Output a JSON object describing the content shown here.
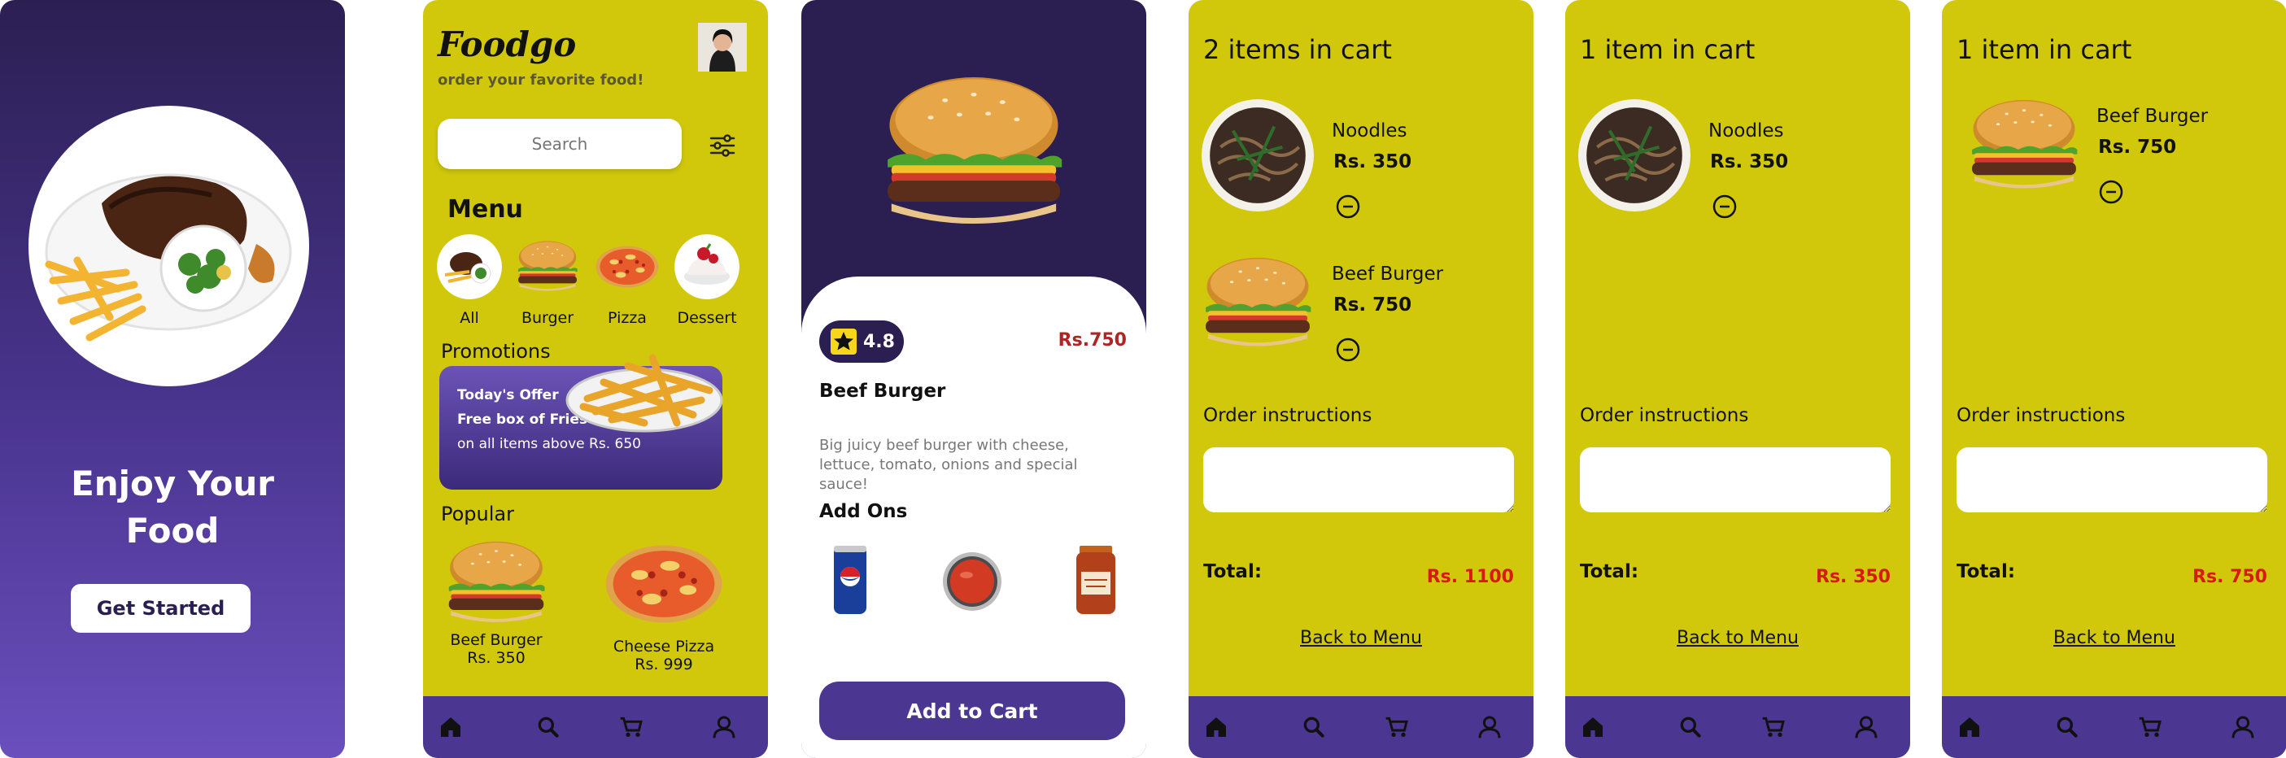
{
  "splash": {
    "title_line1": "Enjoy Your",
    "title_line2": "Food",
    "cta": "Get Started"
  },
  "home": {
    "brand": "Foodgo",
    "tagline": "order your favorite food!",
    "search_placeholder": "Search",
    "menu_title": "Menu",
    "categories": [
      {
        "label": "All",
        "icon": "steak-plate"
      },
      {
        "label": "Burger",
        "icon": "burger"
      },
      {
        "label": "Pizza",
        "icon": "pizza"
      },
      {
        "label": "Dessert",
        "icon": "dessert"
      }
    ],
    "promotions_title": "Promotions",
    "promo": {
      "line1": "Today's Offer",
      "line2": "Free box of Fries",
      "line3": "on all items above Rs. 650"
    },
    "popular_title": "Popular",
    "popular": [
      {
        "name": "Beef Burger",
        "price": "Rs. 350"
      },
      {
        "name": "Cheese Pizza",
        "price": "Rs. 999"
      }
    ]
  },
  "detail": {
    "rating": "4.8",
    "price": "Rs.750",
    "name": "Beef Burger",
    "description": "Big juicy beef burger with cheese, lettuce, tomato, onions and special sauce!",
    "addons_title": "Add Ons",
    "addons": [
      "pepsi-can",
      "tomato-sauce-bowl",
      "sauce-jar"
    ],
    "cta": "Add to Cart"
  },
  "carts": [
    {
      "title": "2 items in cart",
      "items": [
        {
          "name": "Noodles",
          "price": "Rs. 350"
        },
        {
          "name": "Beef Burger",
          "price": "Rs. 750"
        }
      ],
      "order_instructions_label": "Order instructions",
      "total_label": "Total:",
      "total": "Rs. 1100",
      "back": "Back to Menu"
    },
    {
      "title": "1 item in cart",
      "items": [
        {
          "name": "Noodles",
          "price": "Rs. 350"
        }
      ],
      "order_instructions_label": "Order instructions",
      "total_label": "Total:",
      "total": "Rs. 350",
      "back": "Back to Menu"
    },
    {
      "title": "1 item in cart",
      "items": [
        {
          "name": "Beef Burger",
          "price": "Rs. 750"
        }
      ],
      "order_instructions_label": "Order instructions",
      "total_label": "Total:",
      "total": "Rs. 750",
      "back": "Back to Menu"
    }
  ],
  "tabbar": [
    "home-icon",
    "search-icon",
    "cart-icon",
    "profile-icon"
  ],
  "colors": {
    "purple_dark": "#2b1f52",
    "purple": "#4b3791",
    "yellow": "#d1c80b",
    "price_red": "#d81a10"
  }
}
